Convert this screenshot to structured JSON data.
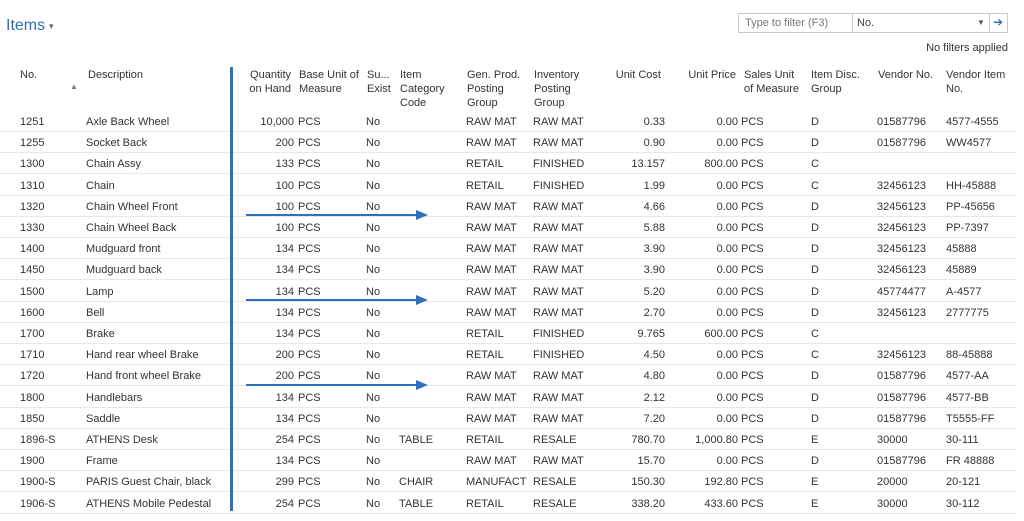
{
  "page": {
    "title": "Items",
    "no_filters": "No filters applied"
  },
  "filter": {
    "placeholder": "Type to filter (F3)",
    "field": "No."
  },
  "columns": {
    "no": "No.",
    "description": "Description",
    "quantity": "Quantity on Hand",
    "base_unit": "Base Unit of Measure",
    "subst": "Su... Exist",
    "item_cat": "Item Category Code",
    "gen_prod": "Gen. Prod. Posting Group",
    "inv_posting": "Inventory Posting Group",
    "unit_cost": "Unit Cost",
    "unit_price": "Unit Price",
    "sales_unit": "Sales Unit of Measure",
    "disc_group": "Item Disc. Group",
    "vendor_no": "Vendor No.",
    "vendor_item": "Vendor Item No."
  },
  "rows": [
    {
      "no": "1251",
      "desc": "Axle Back Wheel",
      "qty": "10,000",
      "unit": "PCS",
      "subst": "No",
      "cat": "",
      "gen": "RAW MAT",
      "inv": "RAW MAT",
      "cost": "0.33",
      "price": "0.00",
      "sunit": "PCS",
      "disc": "D",
      "vendor": "01587796",
      "vitem": "4577-4555"
    },
    {
      "no": "1255",
      "desc": "Socket Back",
      "qty": "200",
      "unit": "PCS",
      "subst": "No",
      "cat": "",
      "gen": "RAW MAT",
      "inv": "RAW MAT",
      "cost": "0.90",
      "price": "0.00",
      "sunit": "PCS",
      "disc": "D",
      "vendor": "01587796",
      "vitem": "WW4577"
    },
    {
      "no": "1300",
      "desc": "Chain Assy",
      "qty": "133",
      "unit": "PCS",
      "subst": "No",
      "cat": "",
      "gen": "RETAIL",
      "inv": "FINISHED",
      "cost": "13.157",
      "price": "800.00",
      "sunit": "PCS",
      "disc": "C",
      "vendor": "",
      "vitem": ""
    },
    {
      "no": "1310",
      "desc": "Chain",
      "qty": "100",
      "unit": "PCS",
      "subst": "No",
      "cat": "",
      "gen": "RETAIL",
      "inv": "FINISHED",
      "cost": "1.99",
      "price": "0.00",
      "sunit": "PCS",
      "disc": "C",
      "vendor": "32456123",
      "vitem": "HH-45888"
    },
    {
      "no": "1320",
      "desc": "Chain Wheel Front",
      "qty": "100",
      "unit": "PCS",
      "subst": "No",
      "cat": "",
      "gen": "RAW MAT",
      "inv": "RAW MAT",
      "cost": "4.66",
      "price": "0.00",
      "sunit": "PCS",
      "disc": "D",
      "vendor": "32456123",
      "vitem": "PP-45656"
    },
    {
      "no": "1330",
      "desc": "Chain Wheel Back",
      "qty": "100",
      "unit": "PCS",
      "subst": "No",
      "cat": "",
      "gen": "RAW MAT",
      "inv": "RAW MAT",
      "cost": "5.88",
      "price": "0.00",
      "sunit": "PCS",
      "disc": "D",
      "vendor": "32456123",
      "vitem": "PP-7397"
    },
    {
      "no": "1400",
      "desc": "Mudguard front",
      "qty": "134",
      "unit": "PCS",
      "subst": "No",
      "cat": "",
      "gen": "RAW MAT",
      "inv": "RAW MAT",
      "cost": "3.90",
      "price": "0.00",
      "sunit": "PCS",
      "disc": "D",
      "vendor": "32456123",
      "vitem": "45888"
    },
    {
      "no": "1450",
      "desc": "Mudguard back",
      "qty": "134",
      "unit": "PCS",
      "subst": "No",
      "cat": "",
      "gen": "RAW MAT",
      "inv": "RAW MAT",
      "cost": "3.90",
      "price": "0.00",
      "sunit": "PCS",
      "disc": "D",
      "vendor": "32456123",
      "vitem": "45889"
    },
    {
      "no": "1500",
      "desc": "Lamp",
      "qty": "134",
      "unit": "PCS",
      "subst": "No",
      "cat": "",
      "gen": "RAW MAT",
      "inv": "RAW MAT",
      "cost": "5.20",
      "price": "0.00",
      "sunit": "PCS",
      "disc": "D",
      "vendor": "45774477",
      "vitem": "A-4577"
    },
    {
      "no": "1600",
      "desc": "Bell",
      "qty": "134",
      "unit": "PCS",
      "subst": "No",
      "cat": "",
      "gen": "RAW MAT",
      "inv": "RAW MAT",
      "cost": "2.70",
      "price": "0.00",
      "sunit": "PCS",
      "disc": "D",
      "vendor": "32456123",
      "vitem": "2777775"
    },
    {
      "no": "1700",
      "desc": "Brake",
      "qty": "134",
      "unit": "PCS",
      "subst": "No",
      "cat": "",
      "gen": "RETAIL",
      "inv": "FINISHED",
      "cost": "9.765",
      "price": "600.00",
      "sunit": "PCS",
      "disc": "C",
      "vendor": "",
      "vitem": ""
    },
    {
      "no": "1710",
      "desc": "Hand rear wheel Brake",
      "qty": "200",
      "unit": "PCS",
      "subst": "No",
      "cat": "",
      "gen": "RETAIL",
      "inv": "FINISHED",
      "cost": "4.50",
      "price": "0.00",
      "sunit": "PCS",
      "disc": "C",
      "vendor": "32456123",
      "vitem": "88-45888"
    },
    {
      "no": "1720",
      "desc": "Hand front wheel Brake",
      "qty": "200",
      "unit": "PCS",
      "subst": "No",
      "cat": "",
      "gen": "RAW MAT",
      "inv": "RAW MAT",
      "cost": "4.80",
      "price": "0.00",
      "sunit": "PCS",
      "disc": "D",
      "vendor": "01587796",
      "vitem": "4577-AA"
    },
    {
      "no": "1800",
      "desc": "Handlebars",
      "qty": "134",
      "unit": "PCS",
      "subst": "No",
      "cat": "",
      "gen": "RAW MAT",
      "inv": "RAW MAT",
      "cost": "2.12",
      "price": "0.00",
      "sunit": "PCS",
      "disc": "D",
      "vendor": "01587796",
      "vitem": "4577-BB"
    },
    {
      "no": "1850",
      "desc": "Saddle",
      "qty": "134",
      "unit": "PCS",
      "subst": "No",
      "cat": "",
      "gen": "RAW MAT",
      "inv": "RAW MAT",
      "cost": "7.20",
      "price": "0.00",
      "sunit": "PCS",
      "disc": "D",
      "vendor": "01587796",
      "vitem": "T5555-FF"
    },
    {
      "no": "1896-S",
      "desc": "ATHENS Desk",
      "qty": "254",
      "unit": "PCS",
      "subst": "No",
      "cat": "TABLE",
      "gen": "RETAIL",
      "inv": "RESALE",
      "cost": "780.70",
      "price": "1,000.80",
      "sunit": "PCS",
      "disc": "E",
      "vendor": "30000",
      "vitem": "30-111"
    },
    {
      "no": "1900",
      "desc": "Frame",
      "qty": "134",
      "unit": "PCS",
      "subst": "No",
      "cat": "",
      "gen": "RAW MAT",
      "inv": "RAW MAT",
      "cost": "15.70",
      "price": "0.00",
      "sunit": "PCS",
      "disc": "D",
      "vendor": "01587796",
      "vitem": "FR 48888"
    },
    {
      "no": "1900-S",
      "desc": "PARIS Guest Chair, black",
      "qty": "299",
      "unit": "PCS",
      "subst": "No",
      "cat": "CHAIR",
      "gen": "MANUFACT",
      "inv": "RESALE",
      "cost": "150.30",
      "price": "192.80",
      "sunit": "PCS",
      "disc": "E",
      "vendor": "20000",
      "vitem": "20-121"
    },
    {
      "no": "1906-S",
      "desc": "ATHENS Mobile Pedestal",
      "qty": "254",
      "unit": "PCS",
      "subst": "No",
      "cat": "TABLE",
      "gen": "RETAIL",
      "inv": "RESALE",
      "cost": "338.20",
      "price": "433.60",
      "sunit": "PCS",
      "disc": "E",
      "vendor": "30000",
      "vitem": "30-112"
    }
  ],
  "colors": {
    "accent": "#2f6fb5",
    "annotation": "#2f6fc0"
  }
}
